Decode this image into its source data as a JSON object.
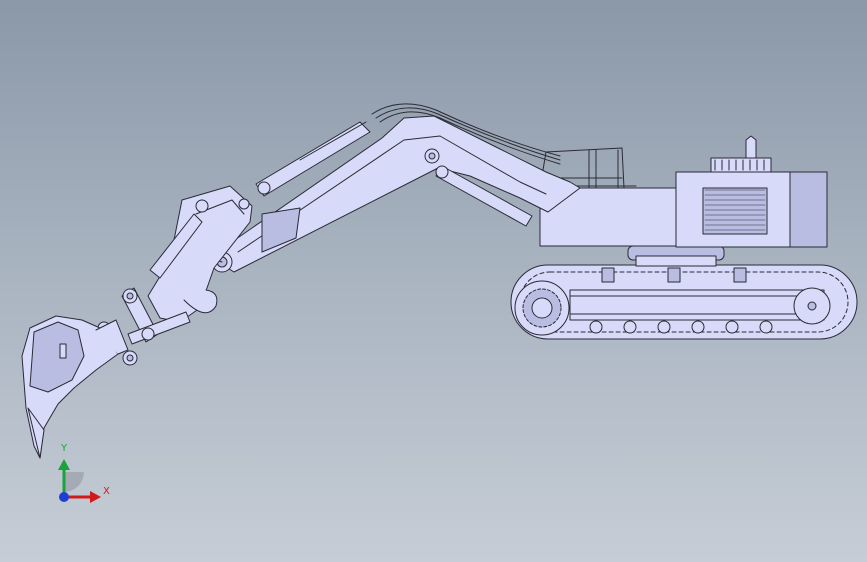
{
  "viewport": {
    "background_top": "#8b98a8",
    "background_bottom": "#c6cdd6",
    "model": "excavator-side-view"
  },
  "colors": {
    "part_fill": "#d7daf8",
    "part_fill_dark": "#b9bde2",
    "edge": "#2b2b36",
    "axis_x": "#d11a1a",
    "axis_y": "#1aa33a",
    "axis_z": "#1d3fd6"
  },
  "triad": {
    "x_label": "X",
    "y_label": "Y",
    "icons": [
      "axis-x-arrow-icon",
      "axis-y-arrow-icon",
      "axis-z-dot-icon"
    ]
  }
}
